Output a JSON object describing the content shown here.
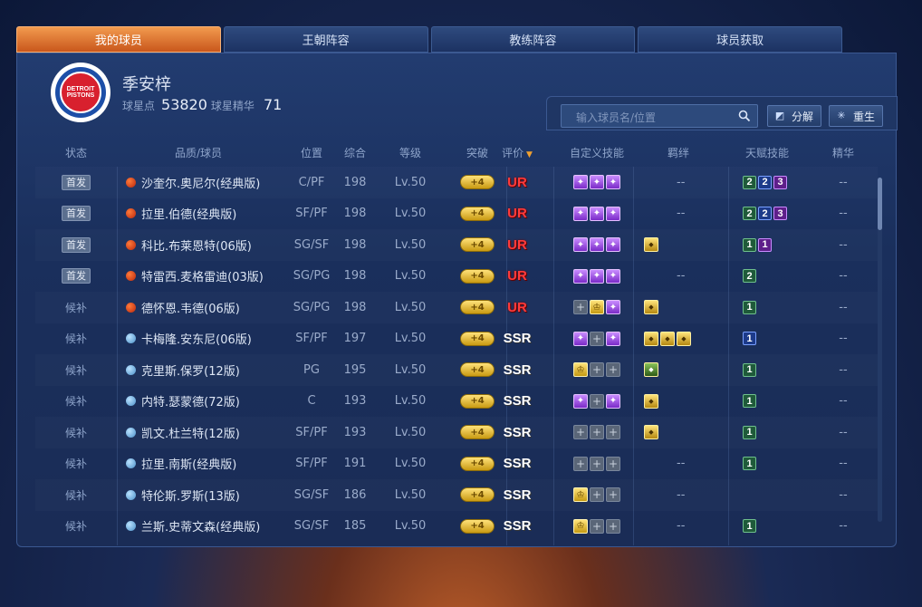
{
  "tabs": [
    "我的球员",
    "王朝阵容",
    "教练阵容",
    "球员获取"
  ],
  "team": {
    "logo_line1": "DETROIT",
    "logo_line2": "PISTONS"
  },
  "profile": {
    "name": "季安梓",
    "points_label": "球星点",
    "points_value": "53820",
    "essence_label": "球星精华",
    "essence_value": "71"
  },
  "search": {
    "placeholder": "输入球员名/位置"
  },
  "buttons": {
    "decompose": "分解",
    "rebirth": "重生"
  },
  "columns": {
    "status": "状态",
    "player": "品质/球员",
    "position": "位置",
    "overall": "综合",
    "level": "等级",
    "breakthrough": "突破",
    "rating": "评价",
    "custom_skills": "自定义技能",
    "bonds": "羁绊",
    "talents": "天赋技能",
    "essence": "精华"
  },
  "players": [
    {
      "status": "首发",
      "starter": true,
      "quality": "ball",
      "name": "沙奎尔.奥尼尔(经典版)",
      "pos": "C/PF",
      "overall": "198",
      "level": "Lv.50",
      "brk": "+4",
      "rating": "UR",
      "skills": [
        "purple",
        "purple",
        "purple"
      ],
      "bonds": [],
      "bonds_text": "--",
      "talents": [
        {
          "v": "2",
          "c": "g"
        },
        {
          "v": "2",
          "c": "b"
        },
        {
          "v": "3",
          "c": "p"
        }
      ],
      "essence": "--"
    },
    {
      "status": "首发",
      "starter": true,
      "quality": "ball",
      "name": "拉里.伯德(经典版)",
      "pos": "SF/PF",
      "overall": "198",
      "level": "Lv.50",
      "brk": "+4",
      "rating": "UR",
      "skills": [
        "purple",
        "purple",
        "purple"
      ],
      "bonds": [],
      "bonds_text": "--",
      "talents": [
        {
          "v": "2",
          "c": "g"
        },
        {
          "v": "2",
          "c": "b"
        },
        {
          "v": "3",
          "c": "p"
        }
      ],
      "essence": "--"
    },
    {
      "status": "首发",
      "starter": true,
      "quality": "ball",
      "name": "科比.布莱恩特(06版)",
      "pos": "SG/SF",
      "overall": "198",
      "level": "Lv.50",
      "brk": "+4",
      "rating": "UR",
      "skills": [
        "purple",
        "purple",
        "purple"
      ],
      "bonds": [
        "gold"
      ],
      "bonds_text": "",
      "talents": [
        {
          "v": "1",
          "c": "g"
        },
        {
          "v": "1",
          "c": "p"
        }
      ],
      "essence": "--"
    },
    {
      "status": "首发",
      "starter": true,
      "quality": "ball",
      "name": "特雷西.麦格雷迪(03版)",
      "pos": "SG/PG",
      "overall": "198",
      "level": "Lv.50",
      "brk": "+4",
      "rating": "UR",
      "skills": [
        "purple",
        "purple",
        "purple"
      ],
      "bonds": [],
      "bonds_text": "--",
      "talents": [
        {
          "v": "2",
          "c": "g"
        }
      ],
      "essence": "--"
    },
    {
      "status": "候补",
      "starter": false,
      "quality": "ball",
      "name": "德怀恩.韦德(06版)",
      "pos": "SG/PG",
      "overall": "198",
      "level": "Lv.50",
      "brk": "+4",
      "rating": "UR",
      "skills": [
        "empty",
        "gold",
        "purple"
      ],
      "bonds": [
        "gold"
      ],
      "bonds_text": "",
      "talents": [
        {
          "v": "1",
          "c": "g"
        }
      ],
      "essence": "--"
    },
    {
      "status": "候补",
      "starter": false,
      "quality": "blue",
      "name": "卡梅隆.安东尼(06版)",
      "pos": "SF/PF",
      "overall": "197",
      "level": "Lv.50",
      "brk": "+4",
      "rating": "SSR",
      "skills": [
        "purple",
        "empty",
        "purple"
      ],
      "bonds": [
        "gold",
        "gold",
        "gold"
      ],
      "bonds_text": "",
      "talents": [
        {
          "v": "1",
          "c": "b"
        }
      ],
      "essence": "--"
    },
    {
      "status": "候补",
      "starter": false,
      "quality": "blue",
      "name": "克里斯.保罗(12版)",
      "pos": "PG",
      "overall": "195",
      "level": "Lv.50",
      "brk": "+4",
      "rating": "SSR",
      "skills": [
        "gold",
        "empty",
        "empty"
      ],
      "bonds": [
        "green"
      ],
      "bonds_text": "",
      "talents": [
        {
          "v": "1",
          "c": "g"
        }
      ],
      "essence": "--"
    },
    {
      "status": "候补",
      "starter": false,
      "quality": "blue",
      "name": "内特.瑟蒙德(72版)",
      "pos": "C",
      "overall": "193",
      "level": "Lv.50",
      "brk": "+4",
      "rating": "SSR",
      "skills": [
        "purple",
        "empty",
        "purple"
      ],
      "bonds": [
        "gold"
      ],
      "bonds_text": "",
      "talents": [
        {
          "v": "1",
          "c": "g"
        }
      ],
      "essence": "--"
    },
    {
      "status": "候补",
      "starter": false,
      "quality": "blue",
      "name": "凯文.杜兰特(12版)",
      "pos": "SF/PF",
      "overall": "193",
      "level": "Lv.50",
      "brk": "+4",
      "rating": "SSR",
      "skills": [
        "empty",
        "empty",
        "empty"
      ],
      "bonds": [
        "gold"
      ],
      "bonds_text": "",
      "talents": [
        {
          "v": "1",
          "c": "g"
        }
      ],
      "essence": "--"
    },
    {
      "status": "候补",
      "starter": false,
      "quality": "blue",
      "name": "拉里.南斯(经典版)",
      "pos": "SF/PF",
      "overall": "191",
      "level": "Lv.50",
      "brk": "+4",
      "rating": "SSR",
      "skills": [
        "empty",
        "empty",
        "empty"
      ],
      "bonds": [],
      "bonds_text": "--",
      "talents": [
        {
          "v": "1",
          "c": "g"
        }
      ],
      "essence": "--"
    },
    {
      "status": "候补",
      "starter": false,
      "quality": "blue",
      "name": "特伦斯.罗斯(13版)",
      "pos": "SG/SF",
      "overall": "186",
      "level": "Lv.50",
      "brk": "+4",
      "rating": "SSR",
      "skills": [
        "gold",
        "empty",
        "empty"
      ],
      "bonds": [],
      "bonds_text": "--",
      "talents": [],
      "essence": "--"
    },
    {
      "status": "候补",
      "starter": false,
      "quality": "blue",
      "name": "兰斯.史蒂文森(经典版)",
      "pos": "SG/SF",
      "overall": "185",
      "level": "Lv.50",
      "brk": "+4",
      "rating": "SSR",
      "skills": [
        "gold",
        "empty",
        "empty"
      ],
      "bonds": [],
      "bonds_text": "--",
      "talents": [
        {
          "v": "1",
          "c": "g"
        }
      ],
      "essence": "--"
    }
  ]
}
